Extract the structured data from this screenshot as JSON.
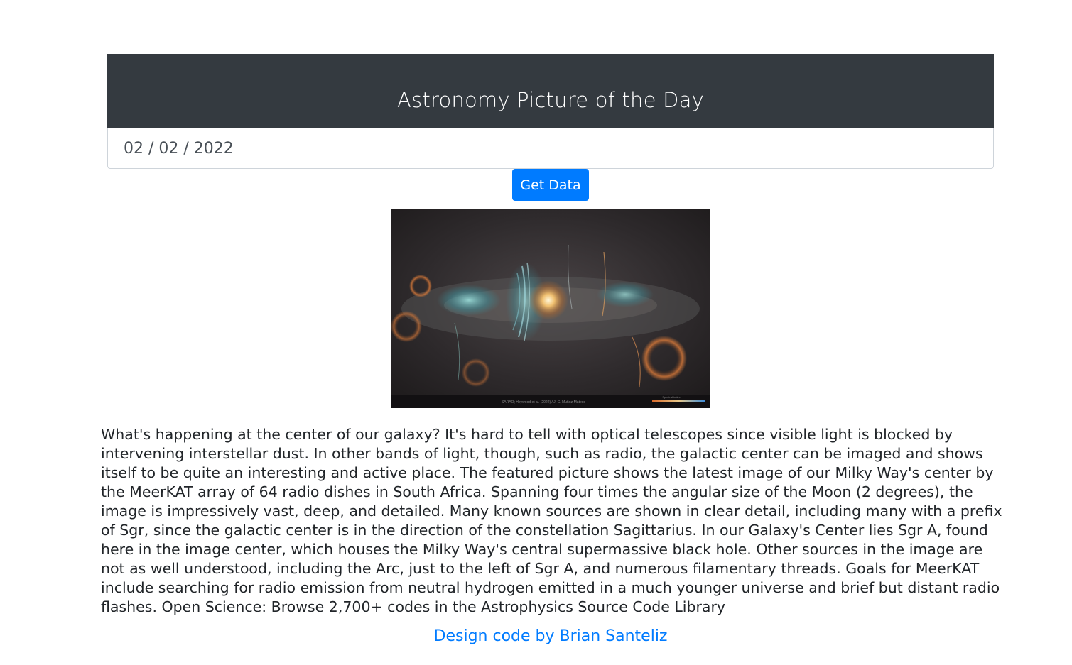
{
  "header": {
    "title": "Astronomy Picture of the Day"
  },
  "date_field": {
    "value": "02 / 02 / 2022"
  },
  "get_button": {
    "label": "Get Data"
  },
  "image": {
    "caption_credit": "SARAO; Heywood et al. (2022) / J. C. Muñoz-Mateos",
    "colorbar_label": "Spectral index"
  },
  "explanation": {
    "text": "What's happening at the center of our galaxy? It's hard to tell with optical telescopes since visible light is blocked by intervening interstellar dust. In other bands of light, though, such as radio, the galactic center can be imaged and shows itself to be quite an interesting and active place. The featured picture shows the latest image of our Milky Way's center by the MeerKAT array of 64 radio dishes in South Africa. Spanning four times the angular size of the Moon (2 degrees), the image is impressively vast, deep, and detailed. Many known sources are shown in clear detail, including many with a prefix of Sgr, since the galactic center is in the direction of the constellation Sagittarius. In our Galaxy's Center lies Sgr A, found here in the image center, which houses the Milky Way's central supermassive black hole. Other sources in the image are not as well understood, including the Arc, just to the left of Sgr A, and numerous filamentary threads. Goals for MeerKAT include searching for radio emission from neutral hydrogen emitted in a much younger universe and brief but distant radio flashes. Open Science: Browse 2,700+ codes in the Astrophysics Source Code Library"
  },
  "footer": {
    "credit_link": "Design code by Brian Santeliz"
  },
  "colors": {
    "header_bg": "#343a40",
    "primary": "#007bff",
    "text": "#212529"
  }
}
